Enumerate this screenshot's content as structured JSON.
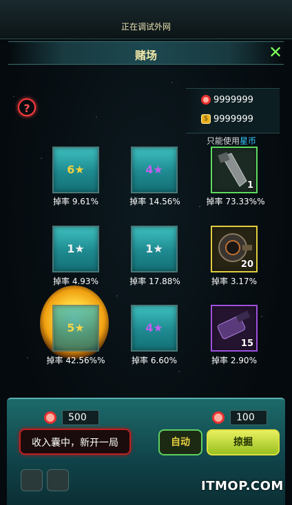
{
  "status_bar": {
    "text": "正在调试外网"
  },
  "header": {
    "title": "赌场",
    "close_icon": "close-icon"
  },
  "help_icon": "help-icon",
  "currency": {
    "coin_red": {
      "icon": "red-coin-icon",
      "amount": "9999999"
    },
    "coin_gold": {
      "icon": "gold-coin-icon",
      "amount": "9999999"
    }
  },
  "note": {
    "prefix": "只能使用",
    "highlight": "星币"
  },
  "colors": {
    "teal_box": "#2aa8ac",
    "green_border": "#5edc5e",
    "yellow_border": "#e0d040",
    "purple_border": "#a050e0",
    "highlight": "#39c8ff"
  },
  "grid": [
    {
      "type": "star",
      "count": "6",
      "star": "gold-star-icon",
      "rate": "掉率 9.61%"
    },
    {
      "type": "star",
      "count": "4",
      "star": "purple-star-icon",
      "rate": "掉率 14.56%"
    },
    {
      "type": "item",
      "item": "knife-blade-item",
      "qty": "1",
      "frame": "green",
      "rate": "掉率 73.33%%"
    },
    {
      "type": "star",
      "count": "1",
      "star": "white-star-icon",
      "rate": "掉率 4.93%"
    },
    {
      "type": "star",
      "count": "1",
      "star": "white-star-icon",
      "rate": "掉率 17.88%"
    },
    {
      "type": "item",
      "item": "engine-part-item",
      "qty": "20",
      "frame": "yellow",
      "rate": "掉率 3.17%"
    },
    {
      "type": "star",
      "count": "5",
      "star": "gold-star-icon",
      "rate": "掉率 42.56%%"
    },
    {
      "type": "star",
      "count": "4",
      "star": "purple-star-icon",
      "rate": "掉率 6.60%"
    },
    {
      "type": "item",
      "item": "cannon-item",
      "qty": "15",
      "frame": "purple",
      "rate": "掉率 2.90%"
    }
  ],
  "bottom": {
    "bet_left": {
      "icon": "red-coin-icon",
      "value": "500"
    },
    "bet_right": {
      "icon": "red-coin-icon",
      "value": "100"
    },
    "restart_button": "收入囊中，新开一局",
    "auto_button": "自动",
    "grab_button": "掠掘"
  },
  "watermark": "ITMOP.COM"
}
